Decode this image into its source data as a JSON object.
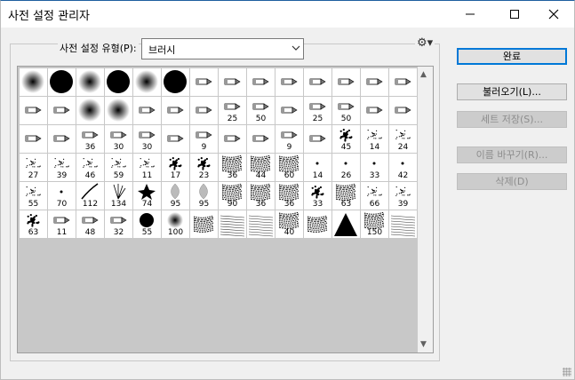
{
  "window": {
    "title": "사전 설정 관리자"
  },
  "preset": {
    "label": "사전 설정 유형(P):",
    "type_value": "브러시"
  },
  "buttons": {
    "done": "완료",
    "load": "불러오기(L)...",
    "save_set": "세트 저장(S)...",
    "rename": "이름 바꾸기(R)...",
    "delete": "삭제(D)"
  },
  "brushes": [
    {
      "k": "soft",
      "s": ""
    },
    {
      "k": "hard",
      "s": ""
    },
    {
      "k": "soft",
      "s": ""
    },
    {
      "k": "hard",
      "s": ""
    },
    {
      "k": "soft",
      "s": ""
    },
    {
      "k": "hard",
      "s": ""
    },
    {
      "k": "tool",
      "s": ""
    },
    {
      "k": "tool",
      "s": ""
    },
    {
      "k": "tool",
      "s": ""
    },
    {
      "k": "tool",
      "s": ""
    },
    {
      "k": "tool",
      "s": ""
    },
    {
      "k": "tool",
      "s": ""
    },
    {
      "k": "tool",
      "s": ""
    },
    {
      "k": "tool",
      "s": ""
    },
    {
      "k": "tool",
      "s": ""
    },
    {
      "k": "tool",
      "s": ""
    },
    {
      "k": "soft",
      "s": ""
    },
    {
      "k": "soft",
      "s": ""
    },
    {
      "k": "tool",
      "s": ""
    },
    {
      "k": "tool",
      "s": ""
    },
    {
      "k": "tool",
      "s": ""
    },
    {
      "k": "tool",
      "s": "25"
    },
    {
      "k": "tool",
      "s": "50"
    },
    {
      "k": "tool",
      "s": ""
    },
    {
      "k": "tool",
      "s": "25"
    },
    {
      "k": "tool",
      "s": "50"
    },
    {
      "k": "tool",
      "s": ""
    },
    {
      "k": "tool",
      "s": ""
    },
    {
      "k": "tool",
      "s": ""
    },
    {
      "k": "tool",
      "s": ""
    },
    {
      "k": "tool",
      "s": "36"
    },
    {
      "k": "tool",
      "s": "30"
    },
    {
      "k": "tool",
      "s": "30"
    },
    {
      "k": "tool",
      "s": ""
    },
    {
      "k": "tool",
      "s": "9"
    },
    {
      "k": "tool",
      "s": ""
    },
    {
      "k": "tool",
      "s": ""
    },
    {
      "k": "tool",
      "s": "9"
    },
    {
      "k": "tool",
      "s": ""
    },
    {
      "k": "splat",
      "s": "45"
    },
    {
      "k": "spark",
      "s": "14"
    },
    {
      "k": "spark",
      "s": "24"
    },
    {
      "k": "spark",
      "s": "27"
    },
    {
      "k": "spark",
      "s": "39"
    },
    {
      "k": "spark",
      "s": "46"
    },
    {
      "k": "spark",
      "s": "59"
    },
    {
      "k": "spark",
      "s": "11"
    },
    {
      "k": "splat",
      "s": "17"
    },
    {
      "k": "splat",
      "s": "23"
    },
    {
      "k": "texture",
      "s": "36"
    },
    {
      "k": "texture",
      "s": "44"
    },
    {
      "k": "texture",
      "s": "60"
    },
    {
      "k": "dot",
      "s": "14"
    },
    {
      "k": "dot",
      "s": "26"
    },
    {
      "k": "dot",
      "s": "33"
    },
    {
      "k": "dot",
      "s": "42"
    },
    {
      "k": "spark",
      "s": "55"
    },
    {
      "k": "dot",
      "s": "70"
    },
    {
      "k": "stroke",
      "s": "112"
    },
    {
      "k": "grass",
      "s": "134"
    },
    {
      "k": "leaf",
      "s": "74"
    },
    {
      "k": "leafl",
      "s": "95"
    },
    {
      "k": "leafl",
      "s": "95"
    },
    {
      "k": "texture",
      "s": "90"
    },
    {
      "k": "texture",
      "s": "36"
    },
    {
      "k": "texture",
      "s": "36"
    },
    {
      "k": "splat",
      "s": "33"
    },
    {
      "k": "texture",
      "s": "63"
    },
    {
      "k": "spark",
      "s": "66"
    },
    {
      "k": "spark",
      "s": "39"
    },
    {
      "k": "splat",
      "s": "63"
    },
    {
      "k": "tool",
      "s": "11"
    },
    {
      "k": "tool",
      "s": "48"
    },
    {
      "k": "tool",
      "s": "32"
    },
    {
      "k": "blob",
      "s": "55"
    },
    {
      "k": "soft",
      "s": "100"
    },
    {
      "k": "texture",
      "s": ""
    },
    {
      "k": "lines",
      "s": ""
    },
    {
      "k": "lines",
      "s": ""
    },
    {
      "k": "texture",
      "s": "40"
    },
    {
      "k": "texture",
      "s": ""
    },
    {
      "k": "triangle",
      "s": ""
    },
    {
      "k": "texture",
      "s": "150"
    },
    {
      "k": "lines",
      "s": ""
    }
  ]
}
